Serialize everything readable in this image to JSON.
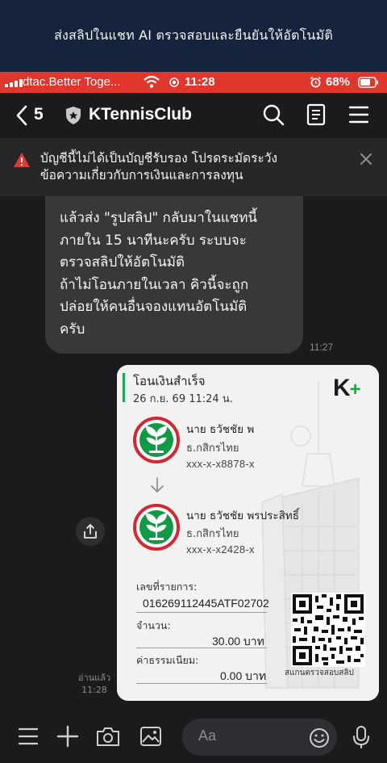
{
  "banner": {
    "text": "ส่งสลิปในแชท AI ตรวจสอบและยืนยันให้อัตโนมัติ"
  },
  "status_bar": {
    "carrier": "dtac.Better Toge...",
    "time": "11:28",
    "battery": "68%",
    "color": "#e0362c"
  },
  "header": {
    "unread_count": "5",
    "title": "KTennisClub"
  },
  "warning": {
    "line1": "บัญชีนี้ไม่ได้เป็นบัญชีรับรอง โปรดระมัดระวัง",
    "line2": "ข้อความเกี่ยวกับการเงินและการลงทุน"
  },
  "messages": {
    "incoming": {
      "lines": [
        "แล้วส่ง \"รูปสลิป\" กลับมาในแชทนี้",
        "ภายใน 15 นาทีนะครับ ระบบจะ",
        "ตรวจสลิปให้อัตโนมัติ",
        "ถ้าไม่โอนภายในเวลา คิวนี้จะถูก",
        "ปล่อยให้คนอื่นจองแทนอัตโนมัติ",
        "ครับ"
      ],
      "time": "11:27"
    },
    "outgoing": {
      "read_label": "อ่านแล้ว",
      "time": "11:28"
    }
  },
  "slip": {
    "title": "โอนเงินสำเร็จ",
    "datetime": "26 ก.ย. 69  11:24 น.",
    "logo_k": "K",
    "logo_plus": "+",
    "sender": {
      "name": "นาย ธวัชชัย พ",
      "bank": "ธ.กสิกรไทย",
      "account": "xxx-x-x8878-x"
    },
    "receiver": {
      "name": "นาย ธวัชชัย พรประสิทธิ์",
      "bank": "ธ.กสิกรไทย",
      "account": "xxx-x-x2428-x"
    },
    "ref_label": "เลขที่รายการ:",
    "ref_value": "016269112445ATF02702",
    "amount_label": "จำนวน:",
    "amount_value": "30.00 บาท",
    "fee_label": "ค่าธรรมเนียม:",
    "fee_value": "0.00 บาท",
    "qr_caption": "สแกนตรวจสอบสลิป",
    "accent_color": "#19a84c"
  },
  "composer": {
    "placeholder": "Aa"
  }
}
